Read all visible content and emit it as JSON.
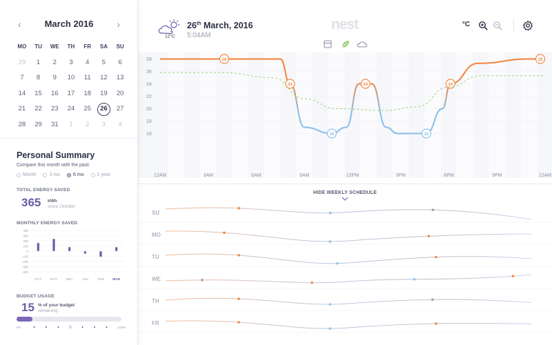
{
  "calendar": {
    "month_label": "March 2016",
    "prev_label": "‹",
    "next_label": "›",
    "weekdays": [
      "MO",
      "TU",
      "WE",
      "TH",
      "FR",
      "SA",
      "SU"
    ],
    "days": [
      {
        "n": "29",
        "muted": true
      },
      {
        "n": "1"
      },
      {
        "n": "2"
      },
      {
        "n": "3"
      },
      {
        "n": "4"
      },
      {
        "n": "5"
      },
      {
        "n": "6"
      },
      {
        "n": "7"
      },
      {
        "n": "8"
      },
      {
        "n": "9"
      },
      {
        "n": "10"
      },
      {
        "n": "11"
      },
      {
        "n": "12"
      },
      {
        "n": "13"
      },
      {
        "n": "14"
      },
      {
        "n": "15"
      },
      {
        "n": "16"
      },
      {
        "n": "17"
      },
      {
        "n": "18"
      },
      {
        "n": "19"
      },
      {
        "n": "20"
      },
      {
        "n": "21"
      },
      {
        "n": "22"
      },
      {
        "n": "23"
      },
      {
        "n": "24"
      },
      {
        "n": "25"
      },
      {
        "n": "26",
        "selected": true
      },
      {
        "n": "27"
      },
      {
        "n": "28"
      },
      {
        "n": "29"
      },
      {
        "n": "31"
      },
      {
        "n": "1",
        "muted": true
      },
      {
        "n": "2",
        "muted": true
      },
      {
        "n": "3",
        "muted": true
      },
      {
        "n": "4",
        "muted": true
      }
    ]
  },
  "summary": {
    "title": "Personal Summary",
    "subtitle": "Compare this month with the past:",
    "ranges": [
      {
        "label": "Month",
        "on": false
      },
      {
        "label": "3 mo",
        "on": false
      },
      {
        "label": "6 mo",
        "on": true
      },
      {
        "label": "1 year",
        "on": false
      }
    ],
    "total_label": "TOTAL ENERGY SAVED",
    "total_value": "365",
    "total_unit": "kWh",
    "total_since": "since October",
    "monthly_label": "MONTHLY ENERGY SAVED",
    "monthly_chart": {
      "type": "bar",
      "y_ticks": [
        "400",
        "300",
        "200",
        "100",
        "0",
        "-100",
        "-200",
        "-300",
        "-400"
      ],
      "categories": [
        "OCT",
        "NOV",
        "DEC",
        "JAN",
        "FEB",
        "MAR"
      ],
      "values": [
        160,
        240,
        80,
        -50,
        -110,
        80
      ],
      "ylim": [
        -400,
        400
      ]
    },
    "budget_label": "BUDGET USAGE",
    "budget_value": "15",
    "budget_text": "% of your budget",
    "budget_sub": "remaining",
    "budget_fraction": 0.15,
    "budget_ticks": [
      "0%",
      "100%"
    ]
  },
  "header": {
    "temp": "12°C",
    "date_day": "26",
    "date_suffix": "th",
    "date_rest": " March, 2016",
    "time": "5:04AM",
    "brand": "nest",
    "unit": "°C"
  },
  "colors": {
    "heat": "#f28a47",
    "cool": "#8fc1ea",
    "eco": "#9bd37a",
    "accent": "#7b68b8"
  },
  "chart_data": {
    "type": "line",
    "y_ticks": [
      "28",
      "26",
      "24",
      "22",
      "20",
      "18",
      "16"
    ],
    "ylim": [
      14.5,
      28.5
    ],
    "x_ticks": [
      "12AM",
      "3AM",
      "6AM",
      "9AM",
      "12PM",
      "3PM",
      "6PM",
      "9PM",
      "12AM"
    ],
    "series": [
      {
        "points": [
          [
            0,
            28
          ],
          [
            4,
            28
          ],
          [
            7.5,
            28
          ],
          [
            8.1,
            24
          ],
          [
            9,
            17
          ],
          [
            10.7,
            16
          ],
          [
            11.6,
            17
          ],
          [
            12.4,
            24
          ],
          [
            13.2,
            24
          ],
          [
            14.1,
            17
          ],
          [
            14.8,
            16
          ],
          [
            16.6,
            16
          ],
          [
            17.6,
            20
          ],
          [
            18.1,
            24
          ],
          [
            19.8,
            27.3
          ],
          [
            23,
            28
          ],
          [
            24,
            28
          ]
        ],
        "markers": [
          {
            "x": 4,
            "y": 28,
            "label": "28"
          },
          {
            "x": 8.1,
            "y": 24,
            "label": "24"
          },
          {
            "x": 10.7,
            "y": 16,
            "label": "16"
          },
          {
            "x": 12.8,
            "y": 24,
            "label": "24"
          },
          {
            "x": 16.6,
            "y": 16,
            "label": "16"
          },
          {
            "x": 18.1,
            "y": 24,
            "label": "24"
          },
          {
            "x": 23.7,
            "y": 28,
            "label": "28"
          }
        ]
      },
      {
        "dashed": true,
        "points": [
          [
            0,
            25.8
          ],
          [
            4,
            25.8
          ],
          [
            7,
            25
          ],
          [
            9,
            21.6
          ],
          [
            11,
            20
          ],
          [
            14,
            19.7
          ],
          [
            16,
            20.3
          ],
          [
            18,
            23.5
          ],
          [
            20,
            25.3
          ],
          [
            24,
            25.3
          ]
        ]
      }
    ]
  },
  "schedule": {
    "toggle_label": "HIDE WEEKLY SCHEDULE",
    "days": [
      {
        "label": "SU",
        "pts": [
          22,
          18,
          31,
          52
        ],
        "dots": [
          [
            0.2,
            "#f28a47"
          ],
          [
            0.45,
            "#8fc1ea"
          ],
          [
            0.73,
            "#9aa0aa"
          ]
        ]
      },
      {
        "label": "MO",
        "pts": [
          22,
          31,
          50,
          30
        ],
        "dots": [
          [
            0.16,
            "#f28a47"
          ],
          [
            0.45,
            "#8fc1ea"
          ],
          [
            0.72,
            "#f28a47"
          ]
        ]
      },
      {
        "label": "TU",
        "pts": [
          28,
          22,
          50,
          38
        ],
        "dots": [
          [
            0.2,
            "#f28a47"
          ],
          [
            0.47,
            "#8fc1ea"
          ],
          [
            0.74,
            "#f28a47"
          ]
        ]
      },
      {
        "label": "WE",
        "pts": [
          38,
          40,
          40,
          20
        ],
        "dots": [
          [
            0.1,
            "#9aa0aa"
          ],
          [
            0.4,
            "#f28a47"
          ],
          [
            0.68,
            "#8fc1ea"
          ],
          [
            0.95,
            "#f28a47"
          ]
        ]
      },
      {
        "label": "TH",
        "pts": [
          30,
          22,
          40,
          37
        ],
        "dots": [
          [
            0.2,
            "#f28a47"
          ],
          [
            0.45,
            "#8fc1ea"
          ],
          [
            0.73,
            "#9aa0aa"
          ]
        ]
      },
      {
        "label": "FR",
        "pts": [
          27,
          30,
          46,
          35
        ],
        "dots": [
          [
            0.2,
            "#f28a47"
          ],
          [
            0.45,
            "#8fc1ea"
          ],
          [
            0.74,
            "#f28a47"
          ]
        ]
      }
    ]
  }
}
